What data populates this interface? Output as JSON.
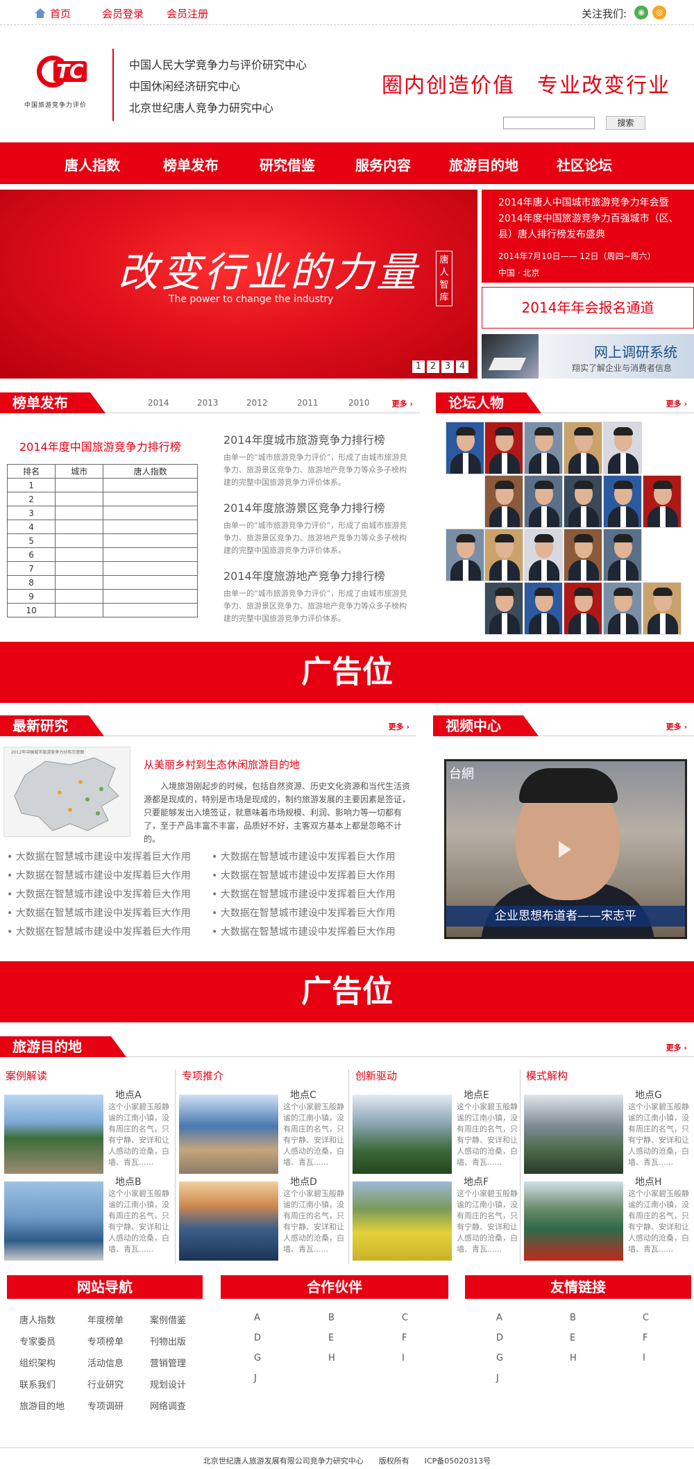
{
  "topbar": {
    "home": "首页",
    "login": "会员登录",
    "register": "会员注册",
    "follow": "关注我们:"
  },
  "header": {
    "logo_text": "TC",
    "logo_sub": "中国旅游竞争力评价",
    "orgs": [
      "中国人民大学竞争力与评价研究中心",
      "中国休闲经济研究中心",
      "北京世纪唐人竞争力研究中心"
    ],
    "slogan": "圈内创造价值　专业改变行业",
    "search_button": "搜索"
  },
  "nav": [
    "唐人指数",
    "榜单发布",
    "研究借鉴",
    "服务内容",
    "旅游目的地",
    "社区论坛"
  ],
  "banner": {
    "headline": "改变行业的力量",
    "english": "The power to change the industry",
    "seal": "唐人智库",
    "pages": [
      "1",
      "2",
      "3",
      "4"
    ]
  },
  "event": {
    "title": "2014年唐人中国城市旅游竞争力年会暨2014年度中国旅游竞争力百强城市（区、县）唐人排行榜发布盛典",
    "date": "2014年7月10日—— 12日（周四~周六）",
    "place": "中国 · 北京"
  },
  "register_channel": "2014年年会报名通道",
  "survey": {
    "title": "网上调研系统",
    "subtitle": "翔实了解企业与消费者信息"
  },
  "rankings": {
    "title": "榜单发布",
    "years": [
      "2014",
      "2013",
      "2012",
      "2011",
      "2010"
    ],
    "more": "更多",
    "table_title": "2014年度中国旅游竞争力排行榜",
    "columns": [
      "排名",
      "城市",
      "唐人指数"
    ],
    "rows": [
      "1",
      "2",
      "3",
      "4",
      "5",
      "6",
      "7",
      "8",
      "9",
      "10"
    ],
    "lists": [
      {
        "title": "2014年度城市旅游竞争力排行榜",
        "desc": "由单一的“城市旅游竞争力评价”，形成了由城市旅游竞争力、旅游景区竞争力、旅游地产竞争力等众多子榜构建的完整中国旅游竞争力评价体系。"
      },
      {
        "title": "2014年度旅游景区竞争力排行榜",
        "desc": "由单一的“城市旅游竞争力评价”，形成了由城市旅游竞争力、旅游景区竞争力、旅游地产竞争力等众多子榜构建的完整中国旅游竞争力评价体系。"
      },
      {
        "title": "2014年度旅游地产竞争力排行榜",
        "desc": "由单一的“城市旅游竞争力评价”，形成了由城市旅游竞争力、旅游景区竞争力、旅游地产竞争力等众多子榜构建的完整中国旅游竞争力评价体系。"
      }
    ]
  },
  "forum": {
    "title": "论坛人物",
    "more": "更多"
  },
  "ad": "广告位",
  "research": {
    "title": "最新研究",
    "more": "更多",
    "article_title": "从美丽乡村到生态休闲旅游目的地",
    "article_body": "入境旅游刚起步的时候，包括自然资源、历史文化资源和当代生活资源都是现成的，特别是市场是现成的，制约旅游发展的主要因素是签证，只要能够发出入境签证，就意味着市场规模、利润、影响力等一切都有了，至于产品丰富不丰富，品质好不好，主客双方基本上都是忽略不计的。",
    "map_caption": "2012年中国城市旅游竞争力分布示意图",
    "bullets": [
      "大数据在智慧城市建设中发挥着巨大作用",
      "大数据在智慧城市建设中发挥着巨大作用",
      "大数据在智慧城市建设中发挥着巨大作用",
      "大数据在智慧城市建设中发挥着巨大作用",
      "大数据在智慧城市建设中发挥着巨大作用",
      "大数据在智慧城市建设中发挥着巨大作用",
      "大数据在智慧城市建设中发挥着巨大作用",
      "大数据在智慧城市建设中发挥着巨大作用",
      "大数据在智慧城市建设中发挥着巨大作用",
      "大数据在智慧城市建设中发挥着巨大作用"
    ]
  },
  "video": {
    "title": "视频中心",
    "more": "更多",
    "caption": "企业思想布道者——宋志平",
    "logo": "台網"
  },
  "destinations": {
    "title": "旅游目的地",
    "more": "更多",
    "categories": [
      "案例解读",
      "专项推介",
      "创新驱动",
      "模式解构"
    ],
    "places": [
      {
        "name": "地点A",
        "desc": "这个小家碧玉般静谧的江南小镇，没有周庄的名气，只有宁静、安详和让人感动的沧桑，白墙、青瓦......"
      },
      {
        "name": "地点B",
        "desc": "这个小家碧玉般静谧的江南小镇，没有周庄的名气，只有宁静、安详和让人感动的沧桑，白墙、青瓦......"
      },
      {
        "name": "地点C",
        "desc": "这个小家碧玉般静谧的江南小镇，没有周庄的名气，只有宁静、安详和让人感动的沧桑，白墙、青瓦......"
      },
      {
        "name": "地点D",
        "desc": "这个小家碧玉般静谧的江南小镇，没有周庄的名气，只有宁静、安详和让人感动的沧桑，白墙、青瓦......"
      },
      {
        "name": "地点E",
        "desc": "这个小家碧玉般静谧的江南小镇，没有周庄的名气，只有宁静、安详和让人感动的沧桑，白墙、青瓦......"
      },
      {
        "name": "地点F",
        "desc": "这个小家碧玉般静谧的江南小镇，没有周庄的名气，只有宁静、安详和让人感动的沧桑，白墙、青瓦......"
      },
      {
        "name": "地点G",
        "desc": "这个小家碧玉般静谧的江南小镇，没有周庄的名气，只有宁静、安详和让人感动的沧桑，白墙、青瓦......"
      },
      {
        "name": "地点H",
        "desc": "这个小家碧玉般静谧的江南小镇，没有周庄的名气，只有宁静、安详和让人感动的沧桑，白墙、青瓦......"
      }
    ]
  },
  "footer": {
    "nav_title": "网站导航",
    "nav_links": [
      "唐人指数",
      "年度榜单",
      "案例借鉴",
      "专家委员",
      "专项榜单",
      "刊物出版",
      "组织架构",
      "活动信息",
      "营销管理",
      "联系我们",
      "行业研究",
      "规划设计",
      "旅游目的地",
      "专项调研",
      "网络调查"
    ],
    "partners_title": "合作伙伴",
    "partners": [
      "A",
      "B",
      "C",
      "D",
      "E",
      "F",
      "G",
      "H",
      "I",
      "J"
    ],
    "links_title": "友情链接",
    "links": [
      "A",
      "B",
      "C",
      "D",
      "E",
      "F",
      "G",
      "H",
      "I",
      "J"
    ],
    "copyright": "北京世纪唐人旅游发展有限公司竞争力研究中心　　版权所有　　ICP备05020313号"
  },
  "colors": {
    "brand_red": "#e60012"
  }
}
